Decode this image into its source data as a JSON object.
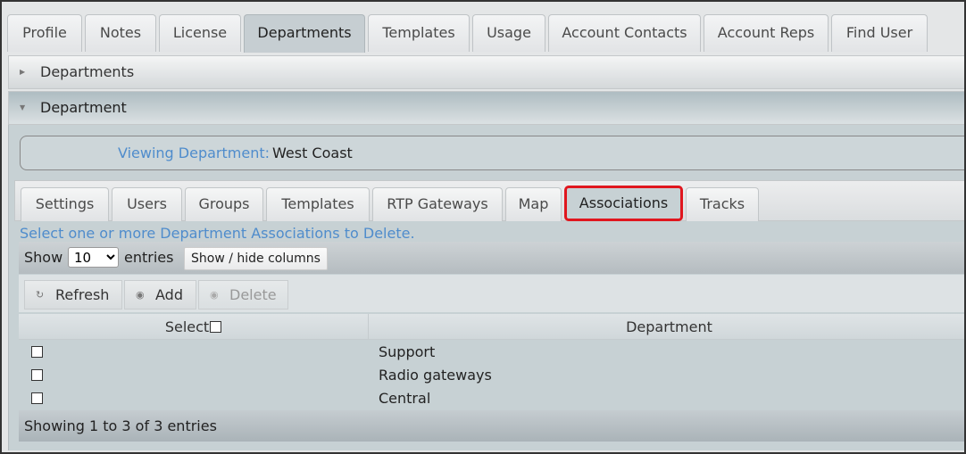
{
  "top_tabs": [
    {
      "label": "Profile"
    },
    {
      "label": "Notes"
    },
    {
      "label": "License"
    },
    {
      "label": "Departments",
      "active": true
    },
    {
      "label": "Templates"
    },
    {
      "label": "Usage"
    },
    {
      "label": "Account Contacts"
    },
    {
      "label": "Account Reps"
    },
    {
      "label": "Find User"
    }
  ],
  "sections": {
    "departments_label": "Departments",
    "department_label": "Department"
  },
  "viewing": {
    "label": "Viewing Department:",
    "value": "West Coast"
  },
  "inner_tabs": [
    {
      "label": "Settings"
    },
    {
      "label": "Users"
    },
    {
      "label": "Groups"
    },
    {
      "label": "Templates"
    },
    {
      "label": "RTP Gateways"
    },
    {
      "label": "Map"
    },
    {
      "label": "Associations",
      "active": true
    },
    {
      "label": "Tracks"
    }
  ],
  "hint": "Select one or more Department Associations to Delete.",
  "show_bar": {
    "show_label": "Show",
    "page_size": "10",
    "entries_label": "entries",
    "columns_button": "Show / hide columns"
  },
  "toolbar": {
    "refresh": "Refresh",
    "add": "Add",
    "delete": "Delete"
  },
  "table": {
    "col_select": "Select",
    "col_department": "Department",
    "rows": [
      {
        "department": "Support"
      },
      {
        "department": "Radio gateways"
      },
      {
        "department": "Central"
      }
    ]
  },
  "footer": "Showing 1 to 3 of 3 entries",
  "colors": {
    "accent_link": "#4f8ccc",
    "highlight_border": "#e0161e"
  }
}
